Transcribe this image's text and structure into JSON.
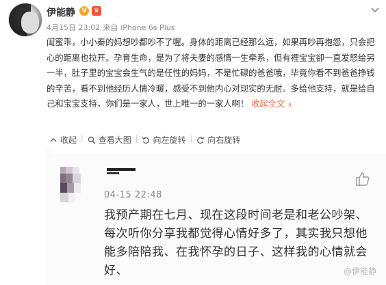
{
  "author": {
    "name": "伊能静",
    "verified_icon": "orange-v-badge",
    "member_icon": "weibo-member-icon"
  },
  "meta": {
    "date": "4月15日 23:02",
    "source_prefix": "来自",
    "source": "iPhone 6s Plus"
  },
  "post": {
    "text": "闺蜜乖，小小秦的妈想吵都吵不了喔。身体的距离已经那么远，如果再吵再抱怨，只会把心的距离也拉开。孕育生命，是为了将夫妻的感情一生牵系，但有裡宝宝卻一直发怒给另一半，肚子里的宝宝会生气的是任性的妈妈，不是忙碌的爸爸哦，毕竟你看不到爸爸挣钱的辛苦，看不到他经历人情冷暖，感受不到他内心对现实的无耐。多给他支持，就是给自己和宝宝支持，你们是一家人，世上唯一的一家人啊！",
    "collapse_label": "收起全文",
    "collapse_arrow": "∧"
  },
  "toolbar": {
    "collapse": "收起",
    "view_large": "查看大图",
    "rotate_left": "向左旋转",
    "rotate_right": "向右旋转"
  },
  "image": {
    "timestamp": "04-15 22:48",
    "message": "我预产期在七月、现在这段时间老是和老公吵架、每次听你分享我都觉得心情好多了，其实我只想他能多陪陪我、在我怀孕的日子、这样我的心情就会好、",
    "watermark": "@伊能静"
  }
}
